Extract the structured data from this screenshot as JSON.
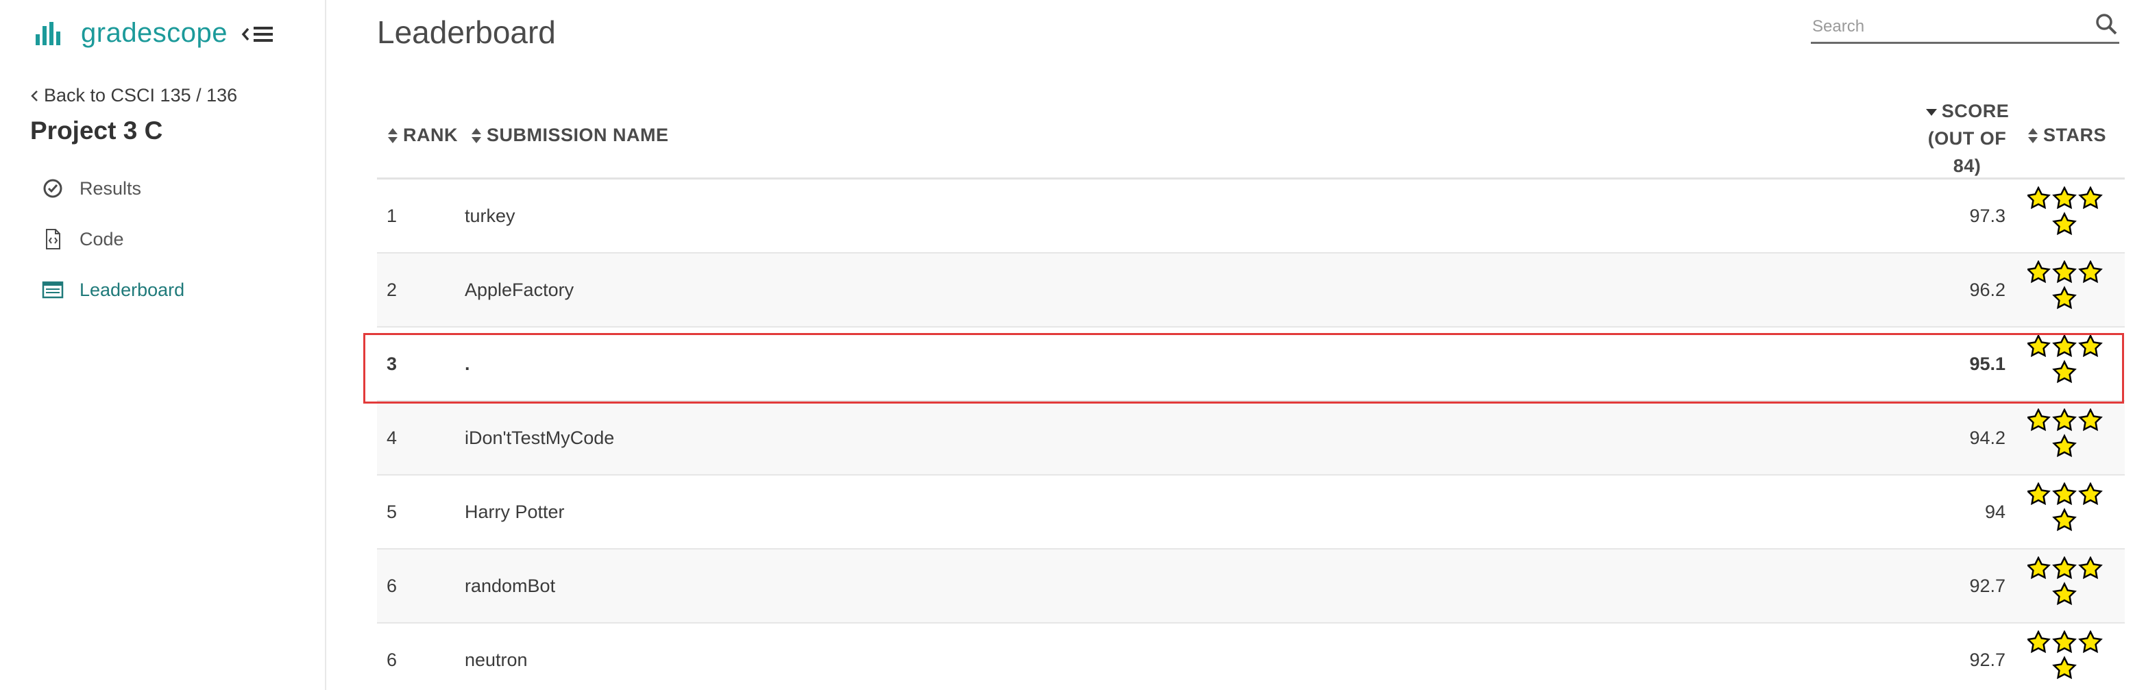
{
  "brand": {
    "name": "gradescope"
  },
  "sidebar": {
    "back_label": "Back to CSCI 135 / 136",
    "course_title": "Project 3 C",
    "items": [
      {
        "label": "Results",
        "icon": "check-circle-icon"
      },
      {
        "label": "Code",
        "icon": "code-file-icon"
      },
      {
        "label": "Leaderboard",
        "icon": "list-icon",
        "active": true
      }
    ]
  },
  "page": {
    "title": "Leaderboard"
  },
  "search": {
    "placeholder": "Search"
  },
  "table": {
    "headers": {
      "rank": "RANK",
      "submission_name": "SUBMISSION NAME",
      "score_line1": "SCORE",
      "score_line2": "(OUT OF",
      "score_line3": "84)",
      "stars": "STARS"
    },
    "rows": [
      {
        "rank": "1",
        "name": "turkey",
        "score": "97.3",
        "stars": 4
      },
      {
        "rank": "2",
        "name": "AppleFactory",
        "score": "96.2",
        "stars": 4
      },
      {
        "rank": "3",
        "name": ".",
        "score": "95.1",
        "stars": 4,
        "highlighted": true
      },
      {
        "rank": "4",
        "name": "iDon'tTestMyCode",
        "score": "94.2",
        "stars": 4
      },
      {
        "rank": "5",
        "name": "Harry Potter",
        "score": "94",
        "stars": 4
      },
      {
        "rank": "6",
        "name": "randomBot",
        "score": "92.7",
        "stars": 4
      },
      {
        "rank": "6",
        "name": "neutron",
        "score": "92.7",
        "stars": 4
      }
    ]
  },
  "colors": {
    "brand": "#1c9a9a",
    "active_nav": "#1f7a7a",
    "highlight_border": "#e23b3b",
    "star_fill": "#ffe600"
  }
}
